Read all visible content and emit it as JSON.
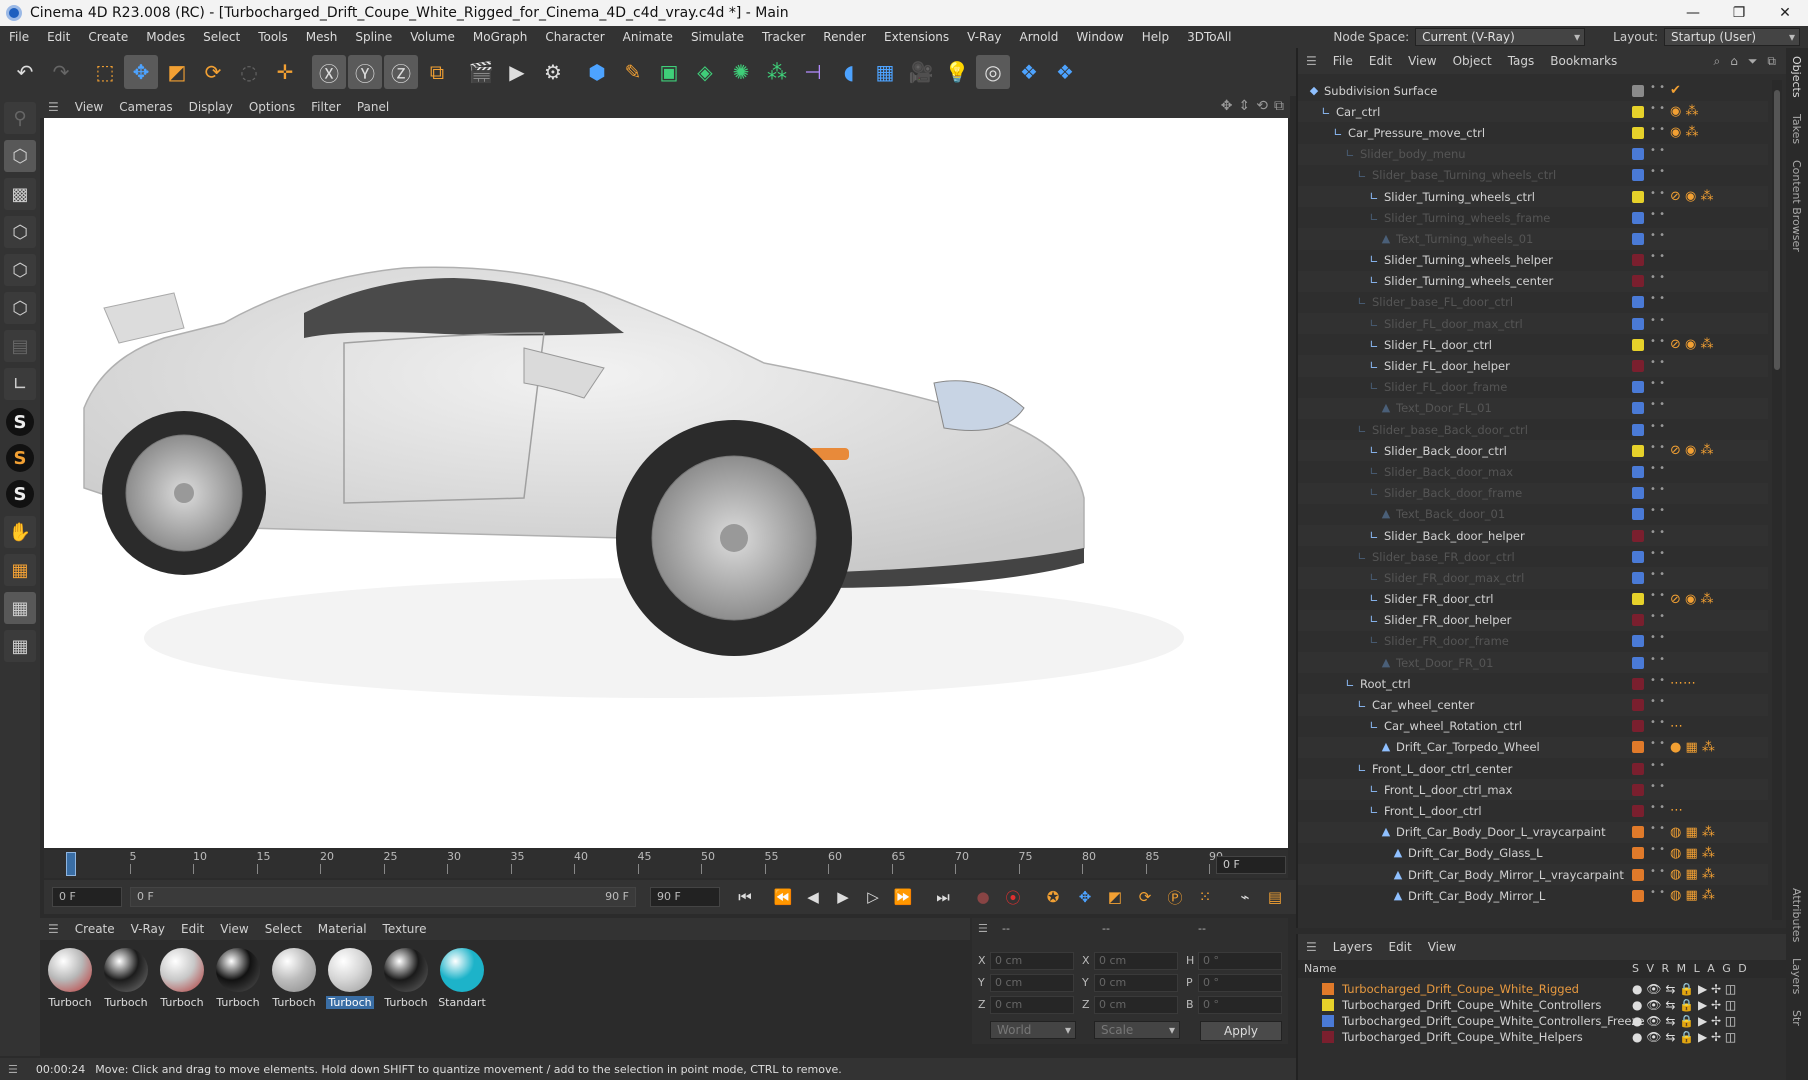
{
  "window": {
    "title": "Cinema 4D R23.008 (RC) - [Turbocharged_Drift_Coupe_White_Rigged_for_Cinema_4D_c4d_vray.c4d *] - Main",
    "minimize": "—",
    "maximize": "❐",
    "close": "✕"
  },
  "menubar": {
    "items": [
      "File",
      "Edit",
      "Create",
      "Modes",
      "Select",
      "Tools",
      "Mesh",
      "Spline",
      "Volume",
      "MoGraph",
      "Character",
      "Animate",
      "Simulate",
      "Tracker",
      "Render",
      "Extensions",
      "V-Ray",
      "Arnold",
      "Window",
      "Help",
      "3DToAll"
    ],
    "node_space_label": "Node Space:",
    "node_space_value": "Current (V-Ray)",
    "layout_label": "Layout:",
    "layout_value": "Startup (User)"
  },
  "viewport_menu": [
    "View",
    "Cameras",
    "Display",
    "Options",
    "Filter",
    "Panel"
  ],
  "timeline": {
    "ticks": [
      "0",
      "5",
      "10",
      "15",
      "20",
      "25",
      "30",
      "35",
      "40",
      "45",
      "50",
      "55",
      "60",
      "65",
      "70",
      "75",
      "80",
      "85",
      "90"
    ],
    "current_frame": "0 F",
    "start_frame": "0 F",
    "range_start": "0 F",
    "range_end": "90 F",
    "end_frame": "90 F"
  },
  "material_menu": [
    "Create",
    "V-Ray",
    "Edit",
    "View",
    "Select",
    "Material",
    "Texture"
  ],
  "materials": [
    {
      "label": "Turboch",
      "color": "#b8b8b8",
      "accent": "#c03030"
    },
    {
      "label": "Turboch",
      "color": "#1c1c1c",
      "accent": "#777777"
    },
    {
      "label": "Turboch",
      "color": "#c8c8c8",
      "accent": "#b03030"
    },
    {
      "label": "Turboch",
      "color": "#121212",
      "accent": "#555555"
    },
    {
      "label": "Turboch",
      "color": "#bdbdbd",
      "accent": "#888888"
    },
    {
      "label": "Turboch",
      "color": "#d6d6d6",
      "accent": "#999999",
      "selected": true
    },
    {
      "label": "Turboch",
      "color": "#1a1a1a",
      "accent": "#666666"
    },
    {
      "label": "Standart",
      "color": "#1db3c9",
      "accent": "#1db3c9"
    }
  ],
  "coords": {
    "header": [
      "--",
      "--",
      "--"
    ],
    "rows": [
      {
        "a": "X",
        "av": "0 cm",
        "b": "X",
        "bv": "0 cm",
        "c": "H",
        "cv": "0 °"
      },
      {
        "a": "Y",
        "av": "0 cm",
        "b": "Y",
        "bv": "0 cm",
        "c": "P",
        "cv": "0 °"
      },
      {
        "a": "Z",
        "av": "0 cm",
        "b": "Z",
        "bv": "0 cm",
        "c": "B",
        "cv": "0 °"
      }
    ],
    "world": "World",
    "scale": "Scale",
    "apply": "Apply"
  },
  "status": {
    "time": "00:00:24",
    "message": "Move: Click and drag to move elements. Hold down SHIFT to quantize movement / add to the selection in point mode, CTRL to remove."
  },
  "object_menu": [
    "File",
    "Edit",
    "View",
    "Object",
    "Tags",
    "Bookmarks"
  ],
  "objects": [
    {
      "name": "Subdivision Surface",
      "indent": 0,
      "dim": false,
      "layer": "#8a8a8a",
      "tags": "✔"
    },
    {
      "name": "Car_ctrl",
      "indent": 1,
      "dim": false,
      "layer": "#e6d12a",
      "tags": "◉ ⁂"
    },
    {
      "name": "Car_Pressure_move_ctrl",
      "indent": 2,
      "dim": false,
      "layer": "#e6d12a",
      "tags": "◉ ⁂"
    },
    {
      "name": "Slider_body_menu",
      "indent": 3,
      "dim": true,
      "layer": "#4a7ad6",
      "tags": ""
    },
    {
      "name": "Slider_base_Turning_wheels_ctrl",
      "indent": 4,
      "dim": true,
      "layer": "#4a7ad6",
      "tags": ""
    },
    {
      "name": "Slider_Turning_wheels_ctrl",
      "indent": 5,
      "dim": false,
      "layer": "#e6d12a",
      "tags": "⊘ ◉ ⁂"
    },
    {
      "name": "Slider_Turning_wheels_frame",
      "indent": 5,
      "dim": true,
      "layer": "#4a7ad6",
      "tags": ""
    },
    {
      "name": "Text_Turning_wheels_01",
      "indent": 6,
      "dim": true,
      "layer": "#4a7ad6",
      "tags": ""
    },
    {
      "name": "Slider_Turning_wheels_helper",
      "indent": 5,
      "dim": false,
      "layer": "#7a1f2e",
      "tags": ""
    },
    {
      "name": "Slider_Turning_wheels_center",
      "indent": 5,
      "dim": false,
      "layer": "#7a1f2e",
      "tags": ""
    },
    {
      "name": "Slider_base_FL_door_ctrl",
      "indent": 4,
      "dim": true,
      "layer": "#4a7ad6",
      "tags": ""
    },
    {
      "name": "Slider_FL_door_max_ctrl",
      "indent": 5,
      "dim": true,
      "layer": "#4a7ad6",
      "tags": ""
    },
    {
      "name": "Slider_FL_door_ctrl",
      "indent": 5,
      "dim": false,
      "layer": "#e6d12a",
      "tags": "⊘ ◉ ⁂"
    },
    {
      "name": "Slider_FL_door_helper",
      "indent": 5,
      "dim": false,
      "layer": "#7a1f2e",
      "tags": ""
    },
    {
      "name": "Slider_FL_door_frame",
      "indent": 5,
      "dim": true,
      "layer": "#4a7ad6",
      "tags": ""
    },
    {
      "name": "Text_Door_FL_01",
      "indent": 6,
      "dim": true,
      "layer": "#4a7ad6",
      "tags": ""
    },
    {
      "name": "Slider_base_Back_door_ctrl",
      "indent": 4,
      "dim": true,
      "layer": "#4a7ad6",
      "tags": ""
    },
    {
      "name": "Slider_Back_door_ctrl",
      "indent": 5,
      "dim": false,
      "layer": "#e6d12a",
      "tags": "⊘ ◉ ⁂"
    },
    {
      "name": "Slider_Back_door_max",
      "indent": 5,
      "dim": true,
      "layer": "#4a7ad6",
      "tags": ""
    },
    {
      "name": "Slider_Back_door_frame",
      "indent": 5,
      "dim": true,
      "layer": "#4a7ad6",
      "tags": ""
    },
    {
      "name": "Text_Back_door_01",
      "indent": 6,
      "dim": true,
      "layer": "#4a7ad6",
      "tags": ""
    },
    {
      "name": "Slider_Back_door_helper",
      "indent": 5,
      "dim": false,
      "layer": "#7a1f2e",
      "tags": ""
    },
    {
      "name": "Slider_base_FR_door_ctrl",
      "indent": 4,
      "dim": true,
      "layer": "#4a7ad6",
      "tags": ""
    },
    {
      "name": "Slider_FR_door_max_ctrl",
      "indent": 5,
      "dim": true,
      "layer": "#4a7ad6",
      "tags": ""
    },
    {
      "name": "Slider_FR_door_ctrl",
      "indent": 5,
      "dim": false,
      "layer": "#e6d12a",
      "tags": "⊘ ◉ ⁂"
    },
    {
      "name": "Slider_FR_door_helper",
      "indent": 5,
      "dim": false,
      "layer": "#7a1f2e",
      "tags": ""
    },
    {
      "name": "Slider_FR_door_frame",
      "indent": 5,
      "dim": true,
      "layer": "#4a7ad6",
      "tags": ""
    },
    {
      "name": "Text_Door_FR_01",
      "indent": 6,
      "dim": true,
      "layer": "#4a7ad6",
      "tags": ""
    },
    {
      "name": "Root_ctrl",
      "indent": 3,
      "dim": false,
      "layer": "#7a1f2e",
      "tags": "⋯⋯"
    },
    {
      "name": "Car_wheel_center",
      "indent": 4,
      "dim": false,
      "layer": "#7a1f2e",
      "tags": ""
    },
    {
      "name": "Car_wheel_Rotation_ctrl",
      "indent": 5,
      "dim": false,
      "layer": "#7a1f2e",
      "tags": "⋯"
    },
    {
      "name": "Drift_Car_Torpedo_Wheel",
      "indent": 6,
      "dim": false,
      "layer": "#e07a2a",
      "tags": "● ▦ ⁂"
    },
    {
      "name": "Front_L_door_ctrl_center",
      "indent": 4,
      "dim": false,
      "layer": "#7a1f2e",
      "tags": ""
    },
    {
      "name": "Front_L_door_ctrl_max",
      "indent": 5,
      "dim": false,
      "layer": "#7a1f2e",
      "tags": ""
    },
    {
      "name": "Front_L_door_ctrl",
      "indent": 5,
      "dim": false,
      "layer": "#7a1f2e",
      "tags": "⋯"
    },
    {
      "name": "Drift_Car_Body_Door_L_vraycarpaint",
      "indent": 6,
      "dim": false,
      "layer": "#e07a2a",
      "tags": "◍ ▦ ⁂"
    },
    {
      "name": "Drift_Car_Body_Glass_L",
      "indent": 7,
      "dim": false,
      "layer": "#e07a2a",
      "tags": "◍ ▦ ⁂"
    },
    {
      "name": "Drift_Car_Body_Mirror_L_vraycarpaint",
      "indent": 7,
      "dim": false,
      "layer": "#e07a2a",
      "tags": "◍ ▦ ⁂"
    },
    {
      "name": "Drift_Car_Body_Mirror_L",
      "indent": 7,
      "dim": false,
      "layer": "#e07a2a",
      "tags": "◍ ▦ ⁂"
    }
  ],
  "side_tabs": [
    "Objects",
    "Takes",
    "Content Browser",
    "Attributes",
    "Layers",
    "Str"
  ],
  "layers_menu": [
    "Layers",
    "Edit",
    "View"
  ],
  "layers_header": {
    "name": "Name",
    "flags": "S V R M L A G D"
  },
  "layers": [
    {
      "name": "Turbocharged_Drift_Coupe_White_Rigged",
      "color": "#e07a2a",
      "text_color": "#e89a40"
    },
    {
      "name": "Turbocharged_Drift_Coupe_White_Controllers",
      "color": "#e6d12a",
      "text_color": "#d2d2d2"
    },
    {
      "name": "Turbocharged_Drift_Coupe_White_Controllers_Freeze",
      "color": "#4a7ad6",
      "text_color": "#d2d2d2"
    },
    {
      "name": "Turbocharged_Drift_Coupe_White_Helpers",
      "color": "#7a1f2e",
      "text_color": "#d2d2d2"
    }
  ]
}
